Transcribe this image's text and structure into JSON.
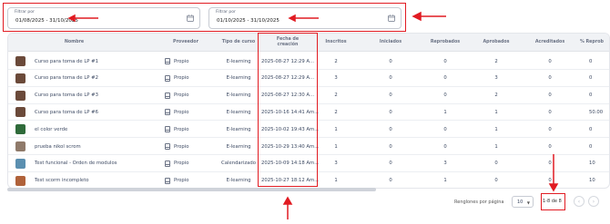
{
  "filters": [
    {
      "label": "Filtrar por",
      "value": "01/08/2025 - 31/10/2025"
    },
    {
      "label": "Filtrar por",
      "value": "01/10/2025 - 31/10/2025"
    }
  ],
  "table": {
    "headers": [
      "Nombre",
      "Proveedor",
      "Tipo de curso",
      "Fecha de creación",
      "Inscritos",
      "Iniciados",
      "Reprobados",
      "Aprobados",
      "Acreditados",
      "% Reprob"
    ],
    "rows": [
      {
        "nombre": "Curso para toma de LP #1",
        "proveedor": "Propio",
        "tipo": "E-learning",
        "fecha": "2025-08-27 12:29 A...",
        "inscritos": "2",
        "iniciados": "0",
        "reprobados": "0",
        "aprobados": "2",
        "acreditados": "0",
        "pct": "0",
        "thumb": "#6b4a3a"
      },
      {
        "nombre": "Curso para toma de LP #2",
        "proveedor": "Propio",
        "tipo": "E-learning",
        "fecha": "2025-08-27 12:29 A...",
        "inscritos": "3",
        "iniciados": "0",
        "reprobados": "0",
        "aprobados": "3",
        "acreditados": "0",
        "pct": "0",
        "thumb": "#6b4a3a"
      },
      {
        "nombre": "Curso para toma de LP #3",
        "proveedor": "Propio",
        "tipo": "E-learning",
        "fecha": "2025-08-27 12:30 A...",
        "inscritos": "2",
        "iniciados": "0",
        "reprobados": "0",
        "aprobados": "2",
        "acreditados": "0",
        "pct": "0",
        "thumb": "#6b4a3a"
      },
      {
        "nombre": "Curso para toma de LP #6",
        "proveedor": "Propio",
        "tipo": "E-learning",
        "fecha": "2025-10-16 14:41 Am...",
        "inscritos": "2",
        "iniciados": "0",
        "reprobados": "1",
        "aprobados": "1",
        "acreditados": "0",
        "pct": "50.00",
        "thumb": "#6b4a3a"
      },
      {
        "nombre": "el color verde",
        "proveedor": "Propio",
        "tipo": "E-learning",
        "fecha": "2025-10-02 19:43 Am...",
        "inscritos": "1",
        "iniciados": "0",
        "reprobados": "0",
        "aprobados": "1",
        "acreditados": "0",
        "pct": "0",
        "thumb": "#2f6b3a"
      },
      {
        "nombre": "prueba nikol scrom",
        "proveedor": "Propio",
        "tipo": "E-learning",
        "fecha": "2025-10-29 13:40 Am...",
        "inscritos": "1",
        "iniciados": "0",
        "reprobados": "0",
        "aprobados": "1",
        "acreditados": "0",
        "pct": "0",
        "thumb": "#8f7a6a"
      },
      {
        "nombre": "Test funcional - Orden de modulos",
        "proveedor": "Propio",
        "tipo": "Calendarizado",
        "fecha": "2025-10-09 14:18 Am...",
        "inscritos": "3",
        "iniciados": "0",
        "reprobados": "3",
        "aprobados": "0",
        "acreditados": "0",
        "pct": "10",
        "thumb": "#5b8fb0"
      },
      {
        "nombre": "Test scorm incompleto",
        "proveedor": "Propio",
        "tipo": "E-learning",
        "fecha": "2025-10-27 18:12 Am...",
        "inscritos": "1",
        "iniciados": "0",
        "reprobados": "1",
        "aprobados": "0",
        "acreditados": "0",
        "pct": "10",
        "thumb": "#b0623a"
      }
    ]
  },
  "pagination": {
    "rows_per_page_label": "Renglones por página",
    "rows_per_page": "10",
    "range": "1-8 de 8",
    "prev_icon": "chevron-left-icon",
    "next_icon": "chevron-right-icon"
  },
  "annotation_color": "#e11b22"
}
